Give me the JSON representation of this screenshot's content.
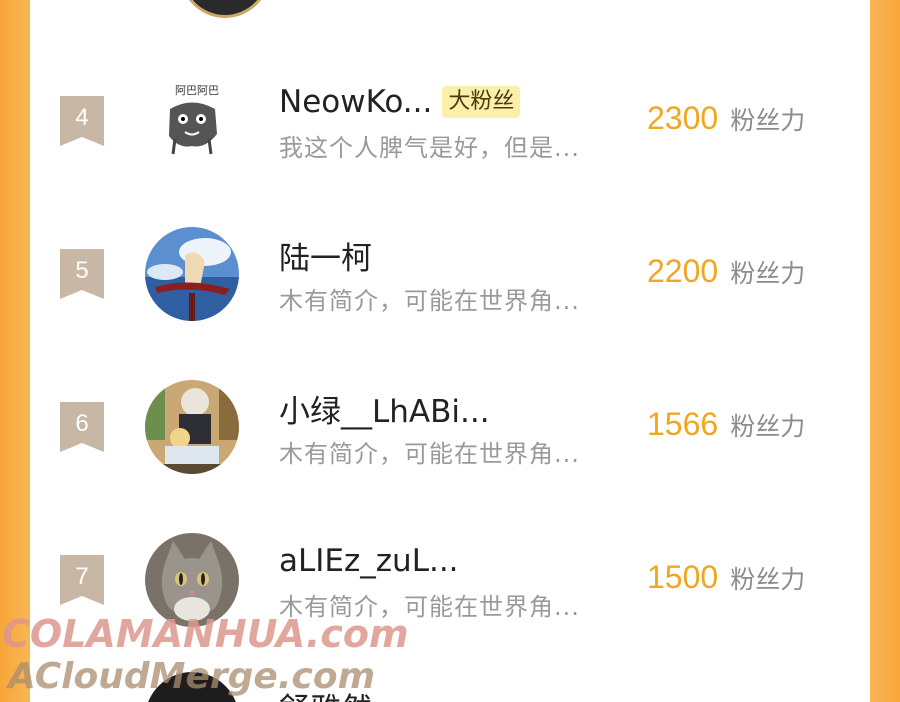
{
  "accent_color": "#f2a61f",
  "rank_badge_color": "#c9b7a6",
  "unit_label": "粉丝力",
  "rows": [
    {
      "rank": "4",
      "name": "NeowKo...",
      "tag": "大粉丝",
      "bio": "我这个人脾气是好，但是...",
      "score": "2300",
      "avatar_icon": "manga-character-sketch-avatar"
    },
    {
      "rank": "5",
      "name": "陆一柯",
      "tag": "",
      "bio": "木有简介，可能在世界角...",
      "score": "2200",
      "avatar_icon": "anime-sky-avatar"
    },
    {
      "rank": "6",
      "name": "小绿__LhABi...",
      "tag": "",
      "bio": "木有简介，可能在世界角...",
      "score": "1566",
      "avatar_icon": "anime-room-avatar"
    },
    {
      "rank": "7",
      "name": "aLIEz_zuL...",
      "tag": "",
      "bio": "木有简介，可能在世界角...",
      "score": "1500",
      "avatar_icon": "gray-cat-avatar"
    }
  ],
  "next_row": {
    "name": "舒雅然 ..."
  },
  "watermark": {
    "line1": "COLAMANHUA.com",
    "line2": "ACloudMerge.com"
  }
}
